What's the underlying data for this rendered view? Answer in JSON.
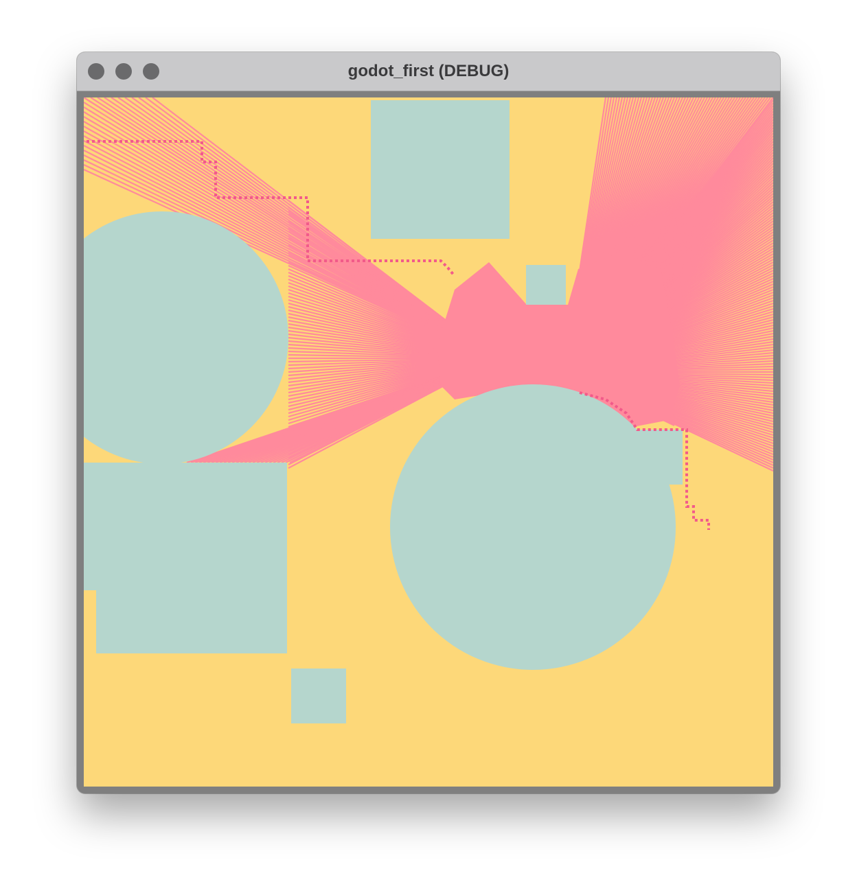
{
  "window": {
    "title": "godot_first (DEBUG)"
  },
  "titlebar": {
    "buttons": [
      {
        "name": "close-button"
      },
      {
        "name": "minimize-button"
      },
      {
        "name": "zoom-button"
      }
    ],
    "button_color": "#6a6a6c"
  },
  "scene": {
    "background_color": "#FDD879",
    "obstacle_color": "#B5D6CD",
    "ray_color": "#FF8A9C",
    "path_color": "#F25A8A"
  }
}
